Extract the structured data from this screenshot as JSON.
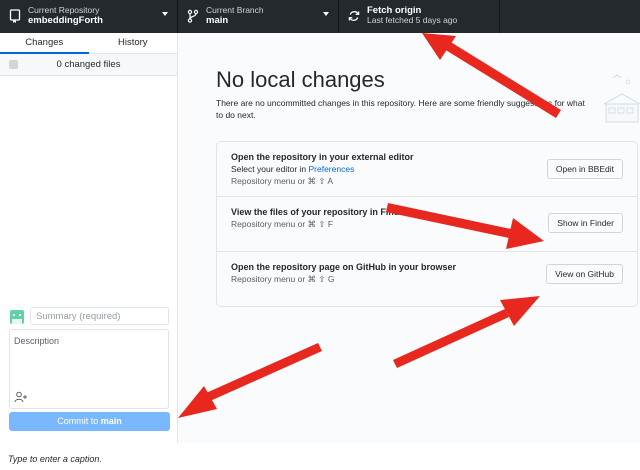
{
  "toolbar": {
    "repo_small": "Current Repository",
    "repo_name": "embeddingForth",
    "branch_small": "Current Branch",
    "branch_name": "main",
    "fetch_title": "Fetch origin",
    "fetch_sub": "Last fetched 5 days ago"
  },
  "sidebar": {
    "tabs": [
      {
        "label": "Changes"
      },
      {
        "label": "History"
      }
    ],
    "changed_files": "0 changed files",
    "summary_placeholder": "Summary (required)",
    "description_placeholder": "Description",
    "commit_prefix": "Commit to ",
    "commit_branch": "main"
  },
  "main": {
    "headline": "No local changes",
    "subtext": "There are no uncommitted changes in this repository. Here are some friendly suggestions for what to do next.",
    "cards": [
      {
        "title": "Open the repository in your external editor",
        "line2_prefix": "Select your editor in ",
        "line2_link": "Preferences",
        "shortcut": "Repository menu or ⌘ ⇧ A",
        "button": "Open in BBEdit"
      },
      {
        "title": "View the files of your repository in Finder",
        "shortcut": "Repository menu or ⌘ ⇧ F",
        "button": "Show in Finder"
      },
      {
        "title": "Open the repository page on GitHub in your browser",
        "shortcut": "Repository menu or ⌘ ⇧ G",
        "button": "View on GitHub"
      }
    ]
  },
  "caption": "Type to enter a caption.",
  "colors": {
    "toolbar": "#24292e",
    "accent": "#0366d6",
    "commit_button": "#79b8ff",
    "annotation_arrow": "#e8281e"
  }
}
